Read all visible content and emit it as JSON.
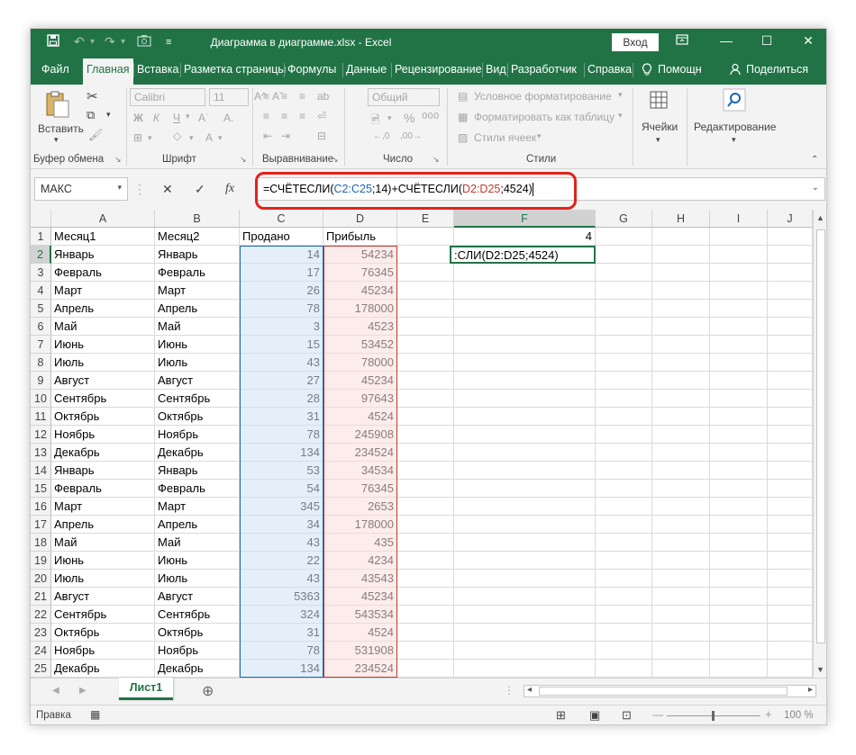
{
  "titlebar": {
    "title": "Диаграмма в диаграмме.xlsx  -  Excel",
    "login_label": "Вход",
    "save_icon": "save-icon",
    "undo_icon": "undo-icon",
    "redo_icon": "redo-icon",
    "camera_icon": "camera-icon",
    "customize_icon": "customize-qat-icon",
    "ribbon_display_icon": "ribbon-display-icon",
    "minimize_icon": "minimize-icon",
    "maximize_icon": "maximize-icon",
    "close_icon": "close-icon"
  },
  "tabs": [
    "Файл",
    "Главная",
    "Вставка",
    "Разметка страницы",
    "Формулы",
    "Данные",
    "Рецензирование",
    "Вид",
    "Разработчик",
    "Справка"
  ],
  "help_search": "Помощн",
  "share_label": "Поделиться",
  "ribbon": {
    "clipboard": {
      "paste_label": "Вставить",
      "group_label": "Буфер обмена"
    },
    "font": {
      "font_name": "Calibri",
      "font_size": "11",
      "bold": "Ж",
      "italic": "К",
      "underline": "Ч",
      "group_label": "Шрифт"
    },
    "alignment": {
      "group_label": "Выравнивание"
    },
    "number": {
      "format": "Общий",
      "group_label": "Число"
    },
    "styles": {
      "conditional": "Условное форматирование",
      "format_table": "Форматировать как таблицу",
      "cell_styles": "Стили ячеек",
      "group_label": "Стили"
    },
    "cells": {
      "label": "Ячейки"
    },
    "editing": {
      "label": "Редактирование"
    }
  },
  "formula_bar": {
    "name_box": "МАКС",
    "fx": "fx",
    "formula_parts": {
      "p1": "=СЧЁТЕСЛИ(",
      "p2": "C2:C25",
      "p3": ";14)+СЧЁТЕСЛИ(",
      "p4": "D2:D25",
      "p5": ";4524)"
    }
  },
  "columns": [
    "A",
    "B",
    "C",
    "D",
    "E",
    "F",
    "G",
    "H",
    "I",
    "J"
  ],
  "header_row": {
    "a": "Месяц1",
    "b": "Месяц2",
    "c": "Продано",
    "d": "Прибыль",
    "f": "4"
  },
  "editing_cell_text": ":СЛИ(D2:D25;4524)",
  "rows": [
    {
      "n": "2",
      "a": "Январь",
      "b": "Январь",
      "c": "14",
      "d": "54234"
    },
    {
      "n": "3",
      "a": "Февраль",
      "b": "Февраль",
      "c": "17",
      "d": "76345"
    },
    {
      "n": "4",
      "a": "Март",
      "b": "Март",
      "c": "26",
      "d": "45234"
    },
    {
      "n": "5",
      "a": "Апрель",
      "b": "Апрель",
      "c": "78",
      "d": "178000"
    },
    {
      "n": "6",
      "a": "Май",
      "b": "Май",
      "c": "3",
      "d": "4523"
    },
    {
      "n": "7",
      "a": "Июнь",
      "b": "Июнь",
      "c": "15",
      "d": "53452"
    },
    {
      "n": "8",
      "a": "Июль",
      "b": "Июль",
      "c": "43",
      "d": "78000"
    },
    {
      "n": "9",
      "a": "Август",
      "b": "Август",
      "c": "27",
      "d": "45234"
    },
    {
      "n": "10",
      "a": "Сентябрь",
      "b": "Сентябрь",
      "c": "28",
      "d": "97643"
    },
    {
      "n": "11",
      "a": "Октябрь",
      "b": "Октябрь",
      "c": "31",
      "d": "4524"
    },
    {
      "n": "12",
      "a": "Ноябрь",
      "b": "Ноябрь",
      "c": "78",
      "d": "245908"
    },
    {
      "n": "13",
      "a": "Декабрь",
      "b": "Декабрь",
      "c": "134",
      "d": "234524"
    },
    {
      "n": "14",
      "a": "Январь",
      "b": "Январь",
      "c": "53",
      "d": "34534"
    },
    {
      "n": "15",
      "a": "Февраль",
      "b": "Февраль",
      "c": "54",
      "d": "76345"
    },
    {
      "n": "16",
      "a": "Март",
      "b": "Март",
      "c": "345",
      "d": "2653"
    },
    {
      "n": "17",
      "a": "Апрель",
      "b": "Апрель",
      "c": "34",
      "d": "178000"
    },
    {
      "n": "18",
      "a": "Май",
      "b": "Май",
      "c": "43",
      "d": "435"
    },
    {
      "n": "19",
      "a": "Июнь",
      "b": "Июнь",
      "c": "22",
      "d": "4234"
    },
    {
      "n": "20",
      "a": "Июль",
      "b": "Июль",
      "c": "43",
      "d": "43543"
    },
    {
      "n": "21",
      "a": "Август",
      "b": "Август",
      "c": "5363",
      "d": "45234"
    },
    {
      "n": "22",
      "a": "Сентябрь",
      "b": "Сентябрь",
      "c": "324",
      "d": "543534"
    },
    {
      "n": "23",
      "a": "Октябрь",
      "b": "Октябрь",
      "c": "31",
      "d": "4524"
    },
    {
      "n": "24",
      "a": "Ноябрь",
      "b": "Ноябрь",
      "c": "78",
      "d": "531908"
    },
    {
      "n": "25",
      "a": "Декабрь",
      "b": "Декабрь",
      "c": "134",
      "d": "234524"
    }
  ],
  "sheet_tab": "Лист1",
  "status": {
    "mode": "Правка",
    "zoom": "100 %"
  }
}
